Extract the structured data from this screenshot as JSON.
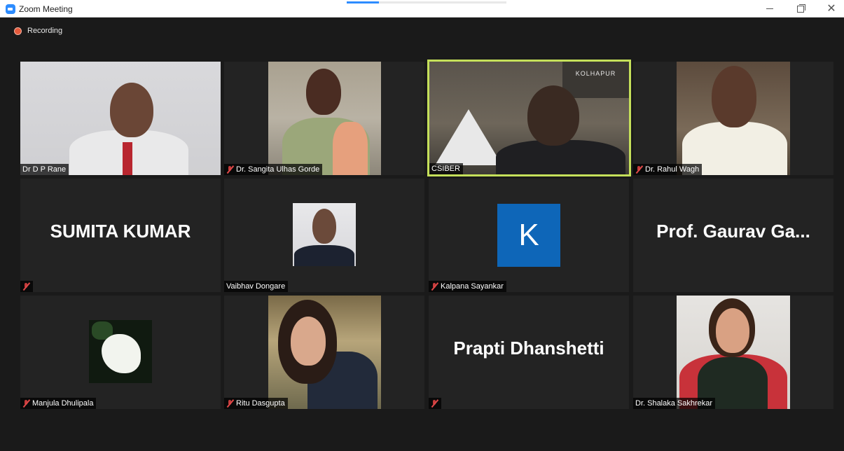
{
  "window": {
    "title": "Zoom Meeting",
    "minimize": "—",
    "close": "✕"
  },
  "recording": {
    "label": "Recording"
  },
  "participants": [
    {
      "name": "Dr D P Rane",
      "muted": false
    },
    {
      "name": "Dr. Sangita Ulhas Gorde",
      "muted": true
    },
    {
      "name": "CSIBER",
      "muted": false,
      "speaking": true,
      "banner_text": "KOLHAPUR"
    },
    {
      "name": "Dr. Rahul Wagh",
      "muted": true
    },
    {
      "name": "",
      "display_name": "SUMITA KUMAR",
      "muted": true
    },
    {
      "name": "Vaibhav Dongare",
      "muted": false
    },
    {
      "name": "Kalpana Sayankar",
      "muted": true,
      "avatar_letter": "K"
    },
    {
      "name": "",
      "display_name": "Prof. Gaurav Ga...",
      "muted": false
    },
    {
      "name": "Manjula Dhulipala",
      "muted": true
    },
    {
      "name": "Ritu Dasgupta",
      "muted": true
    },
    {
      "name": "",
      "display_name": "Prapti Dhanshetti",
      "muted": true
    },
    {
      "name": "Dr. Shalaka Sakhrekar",
      "muted": false
    }
  ],
  "colors": {
    "speaking_outline": "#c5e05a",
    "avatar_k": "#0e66b8",
    "zoom_blue": "#2d8cff",
    "mute_red": "#e04848"
  },
  "icons": {
    "app": "zoom-app-icon",
    "record": "record-dot-icon",
    "mute": "mic-muted-icon"
  }
}
